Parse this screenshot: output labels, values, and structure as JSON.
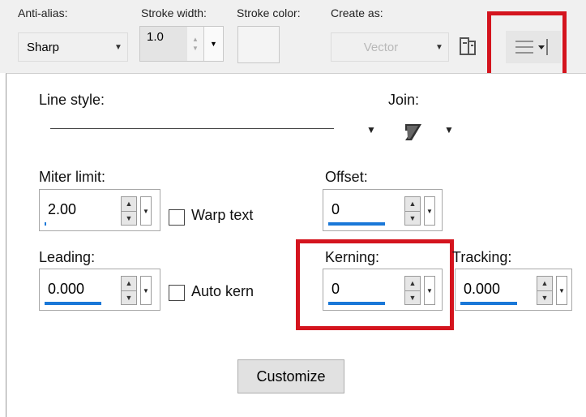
{
  "toolbar": {
    "anti_alias_label": "Anti-alias:",
    "anti_alias_value": "Sharp",
    "stroke_width_label": "Stroke width:",
    "stroke_width_value": "1.0",
    "stroke_color_label": "Stroke color:",
    "create_as_label": "Create as:",
    "create_as_value": "Vector"
  },
  "panel": {
    "line_style_label": "Line style:",
    "join_label": "Join:",
    "miter_limit_label": "Miter limit:",
    "miter_limit_value": "2.00",
    "warp_text_label": "Warp text",
    "warp_text_checked": false,
    "offset_label": "Offset:",
    "offset_value": "0",
    "leading_label": "Leading:",
    "leading_value": "0.000",
    "auto_kern_label": "Auto kern",
    "auto_kern_checked": false,
    "kerning_label": "Kerning:",
    "kerning_value": "0",
    "tracking_label": "Tracking:",
    "tracking_value": "0.000",
    "customize_label": "Customize"
  },
  "colors": {
    "highlight": "#d4141e",
    "field_underline": "#1a78d8",
    "toolbar_bg": "#f0f0f0"
  },
  "icons": [
    "chevron-down-icon",
    "spin-up-icon",
    "spin-down-icon",
    "text-options-icon",
    "menu-lines-icon",
    "join-style-icon"
  ]
}
